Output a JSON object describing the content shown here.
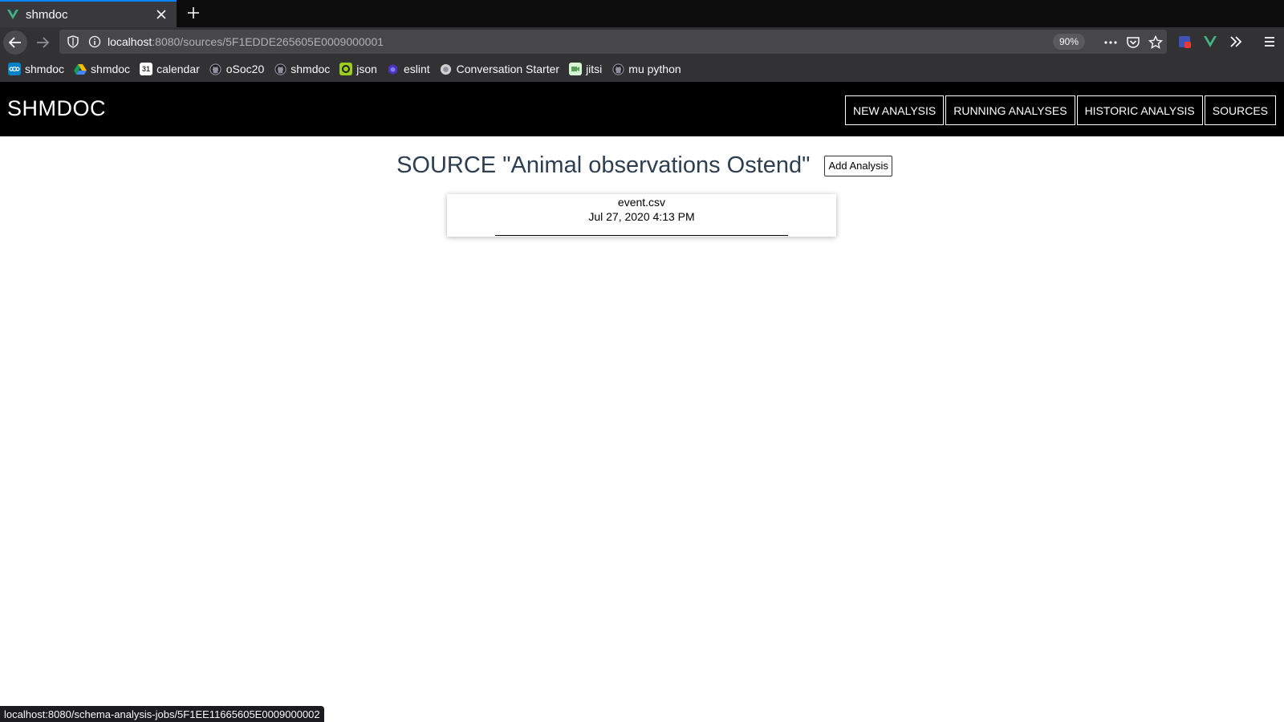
{
  "browser": {
    "tab": {
      "title": "shmdoc"
    },
    "url": {
      "host": "localhost",
      "rest": ":8080/sources/5F1EDDE265605E0009000001"
    },
    "zoom": "90%",
    "bookmarks": [
      {
        "label": "shmdoc",
        "icon": "nextcloud-icon"
      },
      {
        "label": "shmdoc",
        "icon": "google-drive-icon"
      },
      {
        "label": "calendar",
        "icon": "calendar-icon"
      },
      {
        "label": "oSoc20",
        "icon": "github-icon"
      },
      {
        "label": "shmdoc",
        "icon": "github-icon"
      },
      {
        "label": "json",
        "icon": "json-icon"
      },
      {
        "label": "eslint",
        "icon": "eslint-icon"
      },
      {
        "label": "Conversation Starter",
        "icon": "conversation-icon"
      },
      {
        "label": "jitsi",
        "icon": "jitsi-icon"
      },
      {
        "label": "mu python",
        "icon": "github-icon"
      }
    ],
    "status_url": "localhost:8080/schema-analysis-jobs/5F1EE11665605E0009000002"
  },
  "app": {
    "brand": "SHMDOC",
    "menu": [
      "NEW ANALYSIS",
      "RUNNING ANALYSES",
      "HISTORIC ANALYSIS",
      "SOURCES"
    ],
    "page_title": "SOURCE \"Animal observations Ostend\"",
    "add_button": "Add Analysis",
    "file": {
      "name": "event.csv",
      "date": "Jul 27, 2020 4:13 PM"
    }
  },
  "colors": {
    "tab_accent": "#0a84ff",
    "vue_green": "#41b883",
    "title_color": "#2c3e50",
    "header_bg": "#000000"
  }
}
